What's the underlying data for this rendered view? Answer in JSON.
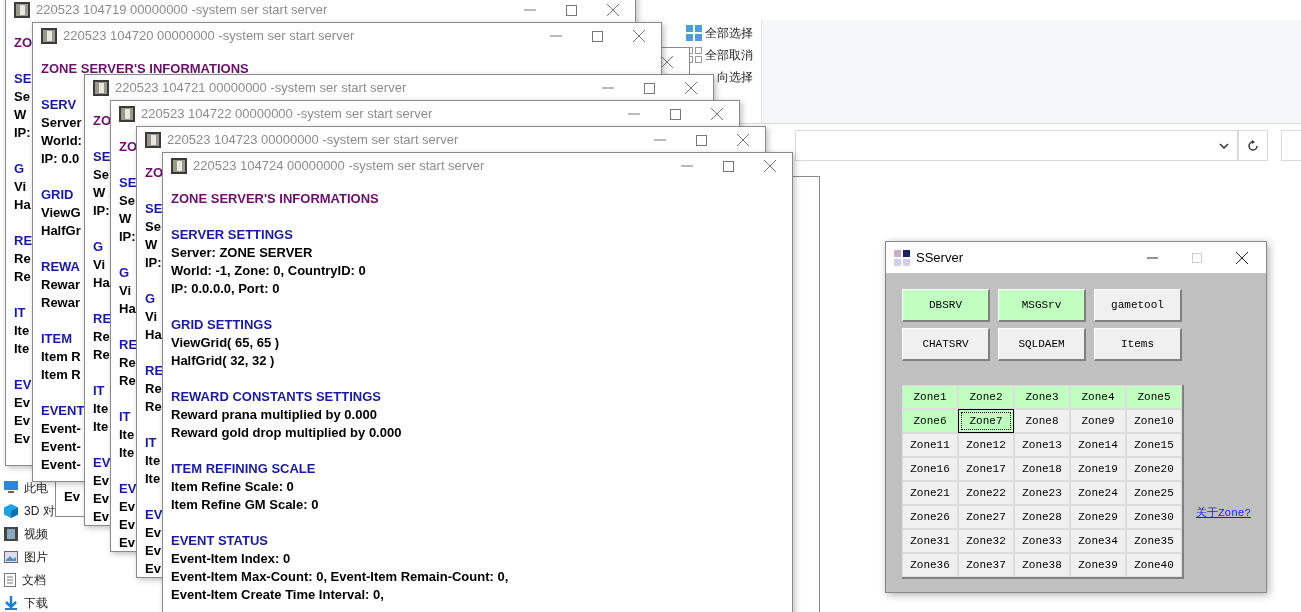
{
  "explorer": {
    "ribbon": [
      {
        "label": "全部选择",
        "kind": "select-all"
      },
      {
        "label": "全部取消",
        "kind": "select-none"
      },
      {
        "label": "向选择",
        "kind": "invert"
      }
    ],
    "nav": [
      {
        "label": "此电",
        "kind": "pc"
      },
      {
        "label": "3D 对",
        "kind": "cube"
      },
      {
        "label": "视频",
        "kind": "video"
      },
      {
        "label": "图片",
        "kind": "image"
      },
      {
        "label": "文档",
        "kind": "doc"
      },
      {
        "label": "下载",
        "kind": "download"
      }
    ]
  },
  "console_windows": [
    {
      "title": "220523 104719 00000000 -system ser start server",
      "heading": "ZO",
      "sections": [
        {
          "heading": "SE",
          "lines": [
            "Se",
            "W",
            "IP:"
          ]
        },
        {
          "heading": "G",
          "lines": [
            "Vi",
            "Ha"
          ]
        },
        {
          "heading": "RE",
          "lines": [
            "Re",
            "Re"
          ]
        },
        {
          "heading": "IT",
          "lines": [
            "Ite",
            "Ite"
          ]
        },
        {
          "heading": "EV",
          "lines": [
            "Ev",
            "Ev",
            "Ev"
          ]
        }
      ]
    },
    {
      "title": "220523 104720 00000000 -system ser start server",
      "heading": "ZONE SERVER'S INFORMATIONS",
      "sections": [
        {
          "heading": "SERV",
          "lines": [
            "Server",
            "World:",
            "IP: 0.0"
          ]
        },
        {
          "heading": "GRID",
          "lines": [
            "ViewG",
            "HalfGr"
          ]
        },
        {
          "heading": "REWA",
          "lines": [
            "Rewar",
            "Rewar"
          ]
        },
        {
          "heading": "ITEM",
          "lines": [
            "Item R",
            "Item R"
          ]
        },
        {
          "heading": "EVENT",
          "lines": [
            "Event-",
            "Event-",
            "Event-"
          ]
        }
      ]
    },
    {
      "title": "220523 104721 00000000 -system ser start server",
      "heading": "ZO",
      "sections": [
        {
          "heading": "SE",
          "lines": [
            "Se",
            "W",
            "IP:"
          ]
        },
        {
          "heading": "G",
          "lines": [
            "Vi",
            "Ha"
          ]
        },
        {
          "heading": "RE",
          "lines": [
            "Re",
            "Re"
          ]
        },
        {
          "heading": "IT",
          "lines": [
            "Ite",
            "Ite"
          ]
        },
        {
          "heading": "EV",
          "lines": [
            "Ev",
            "Ev",
            "Ev"
          ]
        }
      ]
    },
    {
      "title": "220523 104722 00000000 -system ser start server",
      "heading": "ZO",
      "sections": [
        {
          "heading": "SE",
          "lines": [
            "Se",
            "W",
            "IP:"
          ]
        },
        {
          "heading": "G",
          "lines": [
            "Vi",
            "Ha"
          ]
        },
        {
          "heading": "RE",
          "lines": [
            "Re",
            "Re"
          ]
        },
        {
          "heading": "IT",
          "lines": [
            "Ite",
            "Ite"
          ]
        },
        {
          "heading": "EV",
          "lines": [
            "Ev",
            "Ev",
            "Ev"
          ]
        }
      ]
    },
    {
      "title": "220523 104723 00000000 -system ser start server",
      "heading": "ZO",
      "sections": [
        {
          "heading": "SE",
          "lines": [
            "Se",
            "W",
            "IP:"
          ]
        },
        {
          "heading": "G",
          "lines": [
            "Vi",
            "Ha"
          ]
        },
        {
          "heading": "RE",
          "lines": [
            "Re",
            "Re"
          ]
        },
        {
          "heading": "IT",
          "lines": [
            "Ite",
            "Ite"
          ]
        },
        {
          "heading": "EV",
          "lines": [
            "Ev",
            "Ev",
            "Ev"
          ]
        }
      ]
    },
    {
      "title": "220523 104724 00000000 -system ser start server",
      "heading": "ZONE SERVER'S INFORMATIONS",
      "sections": [
        {
          "heading": "SERVER SETTINGS",
          "lines": [
            "Server: ZONE SERVER",
            "World: -1, Zone: 0, CountryID: 0",
            "IP: 0.0.0.0, Port: 0"
          ]
        },
        {
          "heading": "GRID SETTINGS",
          "lines": [
            "ViewGrid( 65, 65 )",
            "HalfGrid( 32, 32 )"
          ]
        },
        {
          "heading": "REWARD CONSTANTS SETTINGS",
          "lines": [
            "Reward prana multiplied by 0.000",
            "Reward gold drop multiplied by 0.000"
          ]
        },
        {
          "heading": "ITEM REFINING SCALE",
          "lines": [
            "Item Refine Scale: 0",
            "Item Refine GM Scale: 0"
          ]
        },
        {
          "heading": "EVENT STATUS",
          "lines": [
            "Event-Item Index: 0",
            "Event-Item Max-Count: 0, Event-Item Remain-Count: 0,",
            "Event-Item Create Time Interval: 0,"
          ]
        }
      ]
    }
  ],
  "hidden_window": {
    "text": "Ev"
  },
  "sserver": {
    "title": "SServer",
    "buttons": [
      {
        "label": "DBSRV",
        "running": true
      },
      {
        "label": "MSGSrv",
        "running": true
      },
      {
        "label": "gametool",
        "running": false
      },
      {
        "label": "CHATSRV",
        "running": false
      },
      {
        "label": "SQLDAEM",
        "running": false
      },
      {
        "label": "Items",
        "running": false
      }
    ],
    "zones": [
      {
        "label": "Zone1",
        "running": true,
        "focused": false
      },
      {
        "label": "Zone2",
        "running": true,
        "focused": false
      },
      {
        "label": "Zone3",
        "running": true,
        "focused": false
      },
      {
        "label": "Zone4",
        "running": true,
        "focused": false
      },
      {
        "label": "Zone5",
        "running": true,
        "focused": false
      },
      {
        "label": "Zone6",
        "running": true,
        "focused": false
      },
      {
        "label": "Zone7",
        "running": true,
        "focused": true
      },
      {
        "label": "Zone8",
        "running": false,
        "focused": false
      },
      {
        "label": "Zone9",
        "running": false,
        "focused": false
      },
      {
        "label": "Zone10",
        "running": false,
        "focused": false
      },
      {
        "label": "Zone11",
        "running": false,
        "focused": false
      },
      {
        "label": "Zone12",
        "running": false,
        "focused": false
      },
      {
        "label": "Zone13",
        "running": false,
        "focused": false
      },
      {
        "label": "Zone14",
        "running": false,
        "focused": false
      },
      {
        "label": "Zone15",
        "running": false,
        "focused": false
      },
      {
        "label": "Zone16",
        "running": false,
        "focused": false
      },
      {
        "label": "Zone17",
        "running": false,
        "focused": false
      },
      {
        "label": "Zone18",
        "running": false,
        "focused": false
      },
      {
        "label": "Zone19",
        "running": false,
        "focused": false
      },
      {
        "label": "Zone20",
        "running": false,
        "focused": false
      },
      {
        "label": "Zone21",
        "running": false,
        "focused": false
      },
      {
        "label": "Zone22",
        "running": false,
        "focused": false
      },
      {
        "label": "Zone23",
        "running": false,
        "focused": false
      },
      {
        "label": "Zone24",
        "running": false,
        "focused": false
      },
      {
        "label": "Zone25",
        "running": false,
        "focused": false
      },
      {
        "label": "Zone26",
        "running": false,
        "focused": false
      },
      {
        "label": "Zone27",
        "running": false,
        "focused": false
      },
      {
        "label": "Zone28",
        "running": false,
        "focused": false
      },
      {
        "label": "Zone29",
        "running": false,
        "focused": false
      },
      {
        "label": "Zone30",
        "running": false,
        "focused": false
      },
      {
        "label": "Zone31",
        "running": false,
        "focused": false
      },
      {
        "label": "Zone32",
        "running": false,
        "focused": false
      },
      {
        "label": "Zone33",
        "running": false,
        "focused": false
      },
      {
        "label": "Zone34",
        "running": false,
        "focused": false
      },
      {
        "label": "Zone35",
        "running": false,
        "focused": false
      },
      {
        "label": "Zone36",
        "running": false,
        "focused": false
      },
      {
        "label": "Zone37",
        "running": false,
        "focused": false
      },
      {
        "label": "Zone38",
        "running": false,
        "focused": false
      },
      {
        "label": "Zone39",
        "running": false,
        "focused": false
      },
      {
        "label": "Zone40",
        "running": false,
        "focused": false
      }
    ],
    "link": "关于Zone?"
  }
}
